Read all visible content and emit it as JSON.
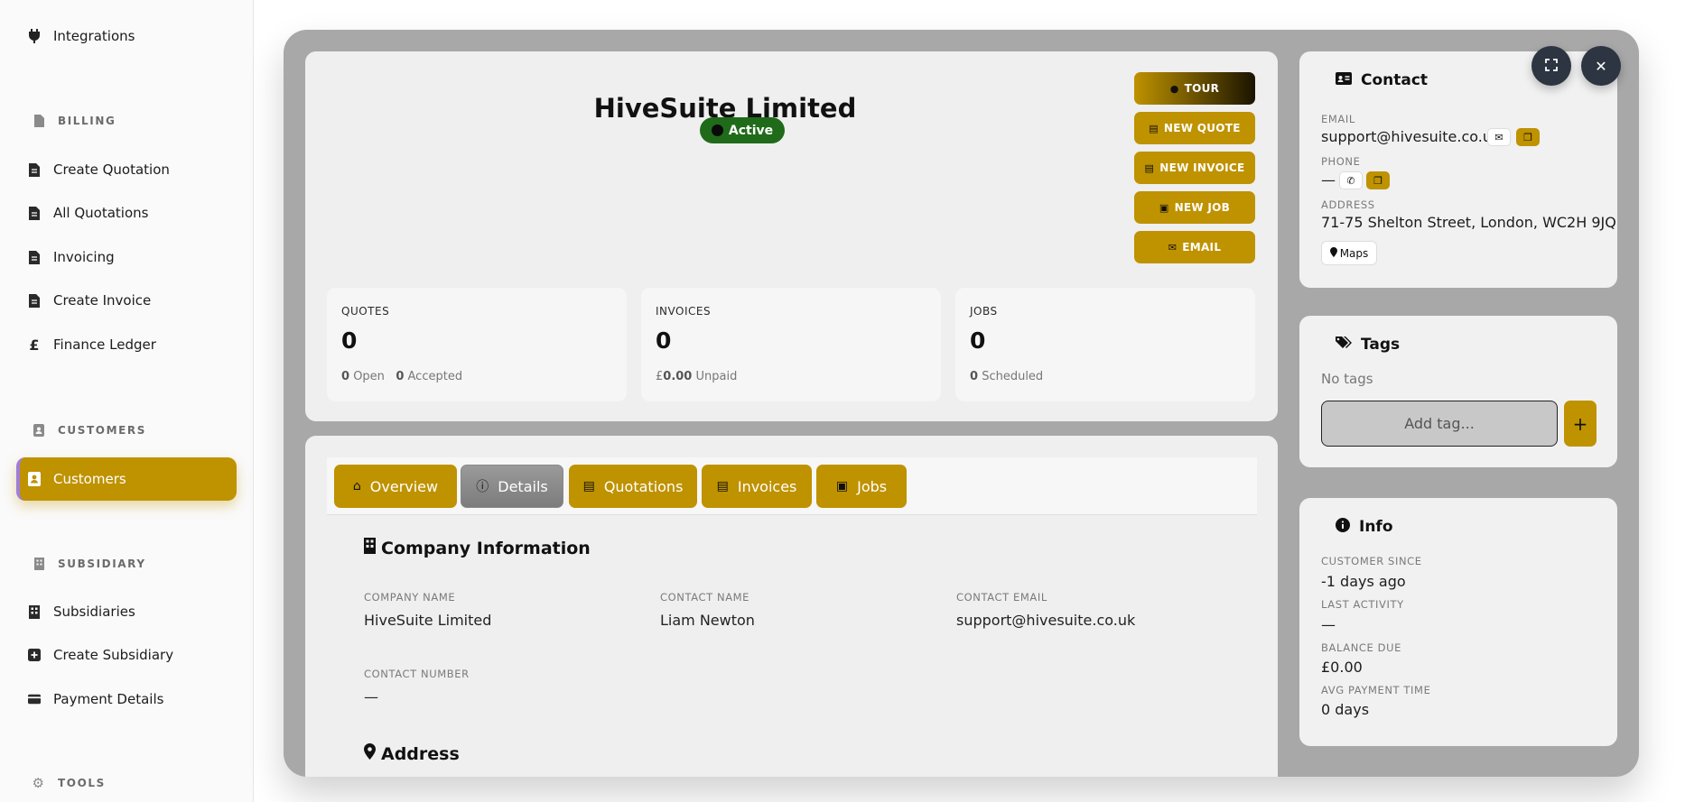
{
  "sidebar": {
    "integrations": "Integrations",
    "billing_heading": "BILLING",
    "create_quotation": "Create Quotation",
    "all_quotations": "All Quotations",
    "invoicing": "Invoicing",
    "create_invoice": "Create Invoice",
    "finance_ledger": "Finance Ledger",
    "customers_heading": "CUSTOMERS",
    "customers": "Customers",
    "subsidiary_heading": "SUBSIDIARY",
    "subsidiaries": "Subsidiaries",
    "create_subsidiary": "Create Subsidiary",
    "payment_details": "Payment Details",
    "tools_heading": "TOOLS"
  },
  "customer": {
    "name": "HiveSuite Limited",
    "status": "Active"
  },
  "actions": {
    "tour": "TOUR",
    "new_quote": "NEW QUOTE",
    "new_invoice": "NEW INVOICE",
    "new_job": "NEW JOB",
    "email": "EMAIL"
  },
  "stats": {
    "quotes_label": "QUOTES",
    "quotes_value": "0",
    "quotes_open_n": "0",
    "quotes_open": "Open",
    "quotes_accepted_n": "0",
    "quotes_accepted": "Accepted",
    "invoices_label": "INVOICES",
    "invoices_value": "0",
    "invoices_currency": "£",
    "invoices_unpaid_amount": "0.00",
    "invoices_unpaid": "Unpaid",
    "jobs_label": "JOBS",
    "jobs_value": "0",
    "jobs_scheduled_n": "0",
    "jobs_scheduled": "Scheduled"
  },
  "tabs": {
    "overview": "Overview",
    "details": "Details",
    "quotations": "Quotations",
    "invoices": "Invoices",
    "jobs": "Jobs"
  },
  "details": {
    "company_section": "Company Information",
    "company_name_label": "COMPANY NAME",
    "company_name": "HiveSuite Limited",
    "contact_name_label": "CONTACT NAME",
    "contact_name": "Liam Newton",
    "contact_email_label": "CONTACT EMAIL",
    "contact_email": "support@hivesuite.co.uk",
    "contact_number_label": "CONTACT NUMBER",
    "contact_number": "—",
    "address_section": "Address"
  },
  "contact": {
    "title": "Contact",
    "email_label": "EMAIL",
    "email": "support@hivesuite.co.uk",
    "phone_label": "PHONE",
    "phone": "—",
    "address_label": "ADDRESS",
    "address": "71-75 Shelton Street, London, WC2H 9JQ",
    "maps": "Maps"
  },
  "tags": {
    "title": "Tags",
    "empty": "No tags",
    "placeholder": "Add tag...",
    "add": "+"
  },
  "info": {
    "title": "Info",
    "since_label": "CUSTOMER SINCE",
    "since": "-1 days ago",
    "last_label": "LAST ACTIVITY",
    "last": "—",
    "balance_label": "BALANCE DUE",
    "balance": "£0.00",
    "avg_label": "AVG PAYMENT TIME",
    "avg": "0 days"
  },
  "colors": {
    "accent": "#bf9200",
    "active_badge": "#1f6b1a",
    "modal_bg": "#a8a8a8"
  }
}
